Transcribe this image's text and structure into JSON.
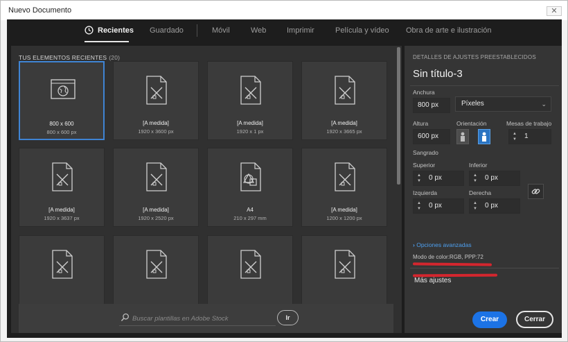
{
  "window": {
    "title": "Nuevo Documento",
    "close_glyph": "✕"
  },
  "tabs": [
    {
      "label": "Recientes",
      "active": true,
      "icon": "clock-icon"
    },
    {
      "label": "Guardado",
      "active": false
    },
    {
      "label": "Móvil",
      "active": false
    },
    {
      "label": "Web",
      "active": false
    },
    {
      "label": "Imprimir",
      "active": false
    },
    {
      "label": "Película y vídeo",
      "active": false
    },
    {
      "label": "Obra de arte e ilustración",
      "active": false
    }
  ],
  "recent": {
    "title": "TUS ELEMENTOS RECIENTES",
    "count": "(20)",
    "items": [
      {
        "icon": "web-document-icon",
        "name": "800 x 600",
        "size": "800 x 600 px",
        "selected": true
      },
      {
        "icon": "custom-document-icon",
        "name": "[A medida]",
        "size": "1920 x 3600 px"
      },
      {
        "icon": "custom-document-icon",
        "name": "[A medida]",
        "size": "1920 x 1 px"
      },
      {
        "icon": "custom-document-icon",
        "name": "[A medida]",
        "size": "1920 x 3665 px"
      },
      {
        "icon": "custom-document-icon",
        "name": "[A medida]",
        "size": "1920 x 3637 px"
      },
      {
        "icon": "custom-document-icon",
        "name": "[A medida]",
        "size": "1920 x 2520 px"
      },
      {
        "icon": "print-document-icon",
        "name": "A4",
        "size": "210 x 297 mm"
      },
      {
        "icon": "custom-document-icon",
        "name": "[A medida]",
        "size": "1200 x 1200 px"
      },
      {
        "icon": "custom-document-icon",
        "name": "",
        "size": ""
      },
      {
        "icon": "custom-document-icon",
        "name": "",
        "size": ""
      },
      {
        "icon": "custom-document-icon",
        "name": "",
        "size": ""
      },
      {
        "icon": "custom-document-icon",
        "name": "",
        "size": ""
      }
    ]
  },
  "search": {
    "placeholder": "Buscar plantillas en Adobe Stock",
    "button": "Ir"
  },
  "details": {
    "header": "DETALLES DE AJUSTES PREESTABLECIDOS",
    "doc_title": "Sin título-3",
    "width_label": "Anchura",
    "width_value": "800 px",
    "unit_value": "Píxeles",
    "height_label": "Altura",
    "height_value": "600 px",
    "orientation_label": "Orientación",
    "artboards_label": "Mesas de trabajo",
    "artboards_value": "1",
    "bleed_label": "Sangrado",
    "top_label": "Superior",
    "top_value": "0 px",
    "bottom_label": "Inferior",
    "bottom_value": "0 px",
    "left_label": "Izquierda",
    "left_value": "0 px",
    "right_label": "Derecha",
    "right_value": "0 px",
    "advanced_label": "Opciones avanzadas",
    "color_mode": "Modo de color:RGB, PPP:72",
    "more_settings": "Más ajustes"
  },
  "buttons": {
    "create": "Crear",
    "close": "Cerrar"
  },
  "colors": {
    "accent": "#1c73e6",
    "selection": "#3f84d4",
    "link": "#4ea0f0",
    "redaction": "#d4262e"
  }
}
